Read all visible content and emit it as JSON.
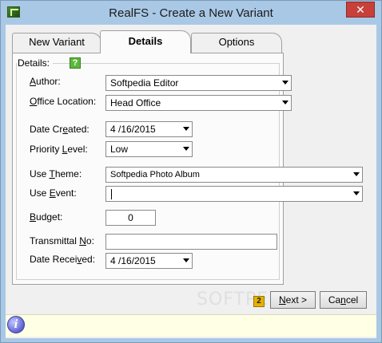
{
  "window": {
    "title": "RealFS - Create a New Variant",
    "close_label": "✕"
  },
  "tabs": [
    {
      "label": "New Variant",
      "active": false
    },
    {
      "label": "Details",
      "active": true
    },
    {
      "label": "Options",
      "active": false
    }
  ],
  "details": {
    "group_label": "Details:",
    "help_badge": "?",
    "fields": {
      "author": {
        "label_pre": "",
        "label_u": "A",
        "label_post": "uthor:",
        "value": "Softpedia Editor"
      },
      "office_location": {
        "label_pre": "",
        "label_u": "O",
        "label_post": "ffice Location:",
        "value": "Head Office"
      },
      "date_created": {
        "label_pre": "Date Cr",
        "label_u": "e",
        "label_post": "ated:",
        "value": "4 /16/2015"
      },
      "priority_level": {
        "label_pre": "Priority ",
        "label_u": "L",
        "label_post": "evel:",
        "value": "Low"
      },
      "use_theme": {
        "label_pre": "Use ",
        "label_u": "T",
        "label_post": "heme:",
        "value": "Softpedia Photo Album"
      },
      "use_event": {
        "label_pre": "Use ",
        "label_u": "E",
        "label_post": "vent:",
        "value": ""
      },
      "budget": {
        "label_pre": "",
        "label_u": "B",
        "label_post": "udget:",
        "value": "0"
      },
      "transmittal_no": {
        "label_pre": "Transmittal ",
        "label_u": "N",
        "label_post": "o:",
        "value": ""
      },
      "date_received": {
        "label_pre": "Date Recei",
        "label_u": "v",
        "label_post": "ed:",
        "value": "4 /16/2015"
      }
    }
  },
  "footer": {
    "step_badge": "2",
    "next_label_pre": "",
    "next_label_u": "N",
    "next_label_post": "ext >",
    "cancel_label_pre": "Ca",
    "cancel_label_u": "n",
    "cancel_label_post": "cel"
  },
  "watermark": "SOFTPEDIA",
  "colors": {
    "titlebar": "#a9c8e6",
    "close": "#c7403a",
    "status_bg": "#ffffe6",
    "help": "#5cb83a",
    "step": "#e6b100"
  }
}
